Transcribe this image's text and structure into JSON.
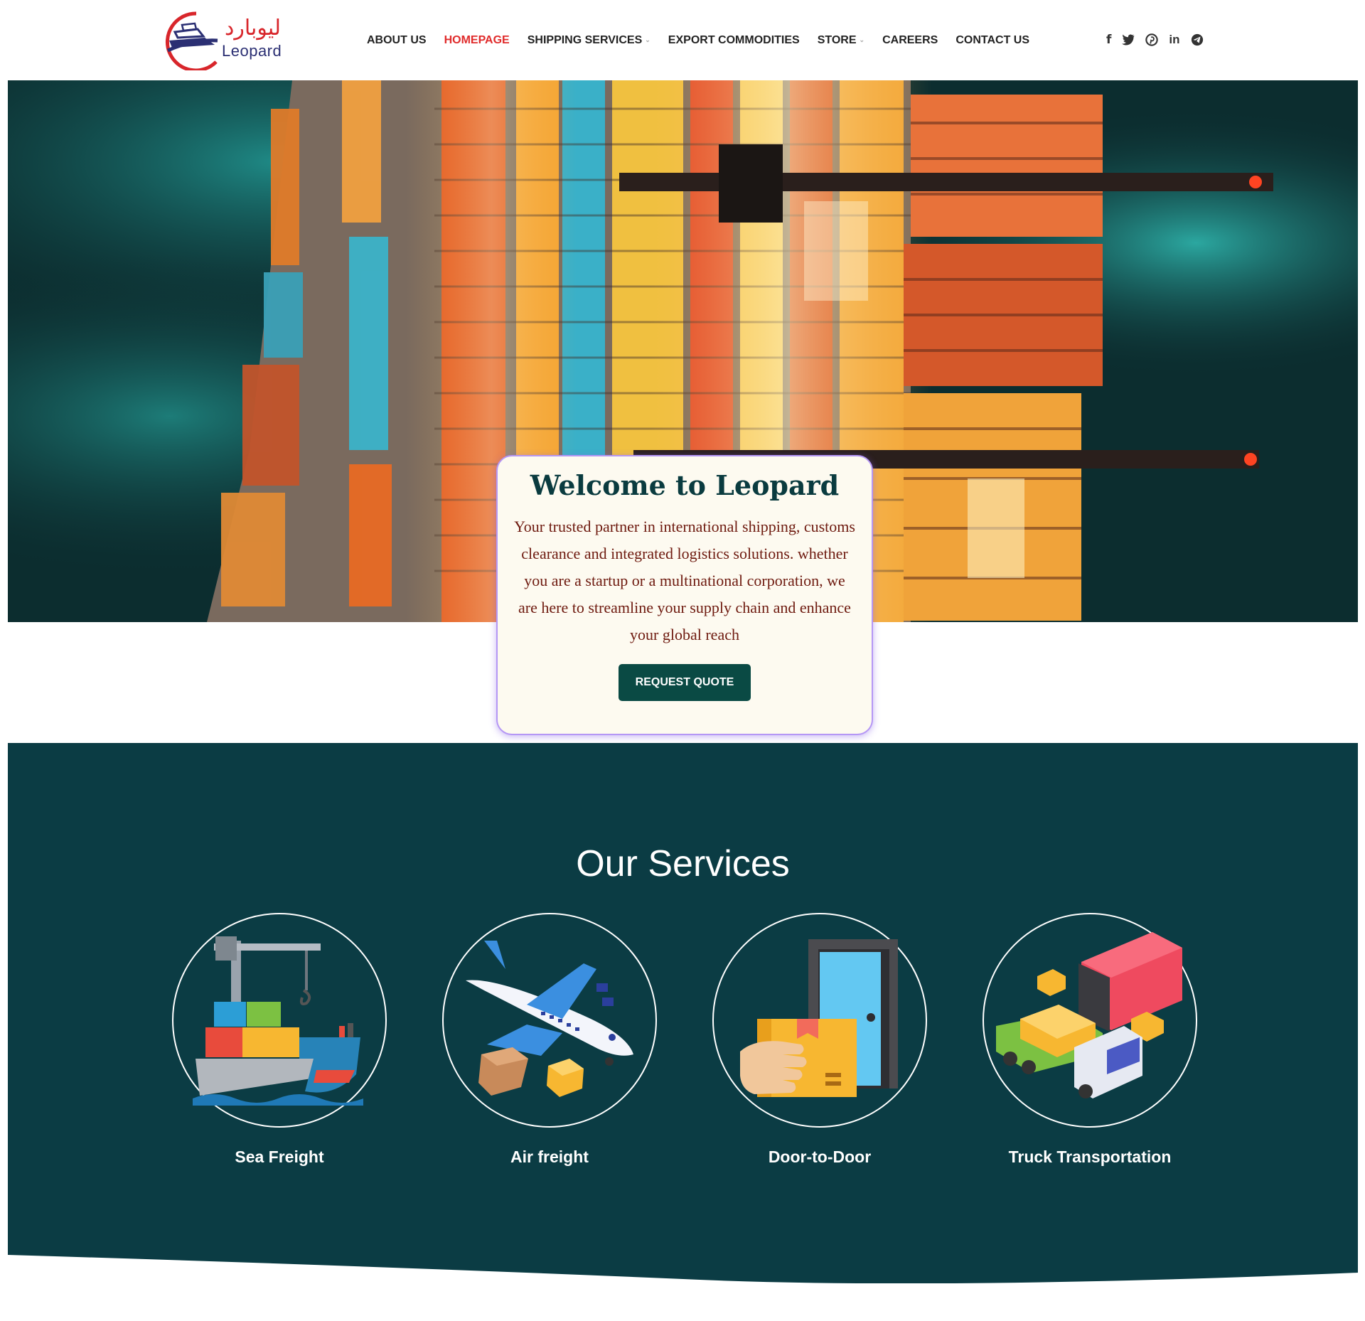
{
  "logo": {
    "arabic_text": "ليوبارد",
    "latin_text": "Leopard",
    "icon": "ship-swoosh-logo"
  },
  "nav": {
    "items": [
      {
        "label": "ABOUT US",
        "active": false,
        "dropdown": false
      },
      {
        "label": "HOMEPAGE",
        "active": true,
        "dropdown": false
      },
      {
        "label": "SHIPPING SERVICES",
        "active": false,
        "dropdown": true
      },
      {
        "label": "EXPORT COMMODITIES",
        "active": false,
        "dropdown": false
      },
      {
        "label": "STORE",
        "active": false,
        "dropdown": true
      },
      {
        "label": "CAREERS",
        "active": false,
        "dropdown": false
      },
      {
        "label": "CONTACT US",
        "active": false,
        "dropdown": false
      }
    ],
    "dropdown_icon": "chevron-down-icon"
  },
  "social": {
    "icons": [
      "facebook-icon",
      "twitter-icon",
      "pinterest-icon",
      "linkedin-icon",
      "telegram-icon"
    ],
    "facebook_glyph": "f",
    "linkedin_glyph": "in"
  },
  "hero": {
    "image": "aerial-container-port-photo"
  },
  "welcome": {
    "title": "Welcome to Leopard",
    "text": "Your trusted partner in international shipping, customs clearance and integrated logistics solutions. whether you are a startup or a multinational corporation, we are here to streamline your supply chain and enhance your global reach",
    "button_label": "REQUEST QUOTE"
  },
  "services": {
    "title": "Our Services",
    "items": [
      {
        "label": "Sea Freight",
        "icon": "cargo-ship-crane-icon"
      },
      {
        "label": "Air freight",
        "icon": "airplane-parcels-icon"
      },
      {
        "label": "Door-to-Door",
        "icon": "hand-box-door-icon"
      },
      {
        "label": "Truck Transportation",
        "icon": "truck-container-icon"
      }
    ]
  },
  "colors": {
    "accent_red": "#e02b2b",
    "teal_dark": "#0b3c44",
    "button_green": "#0a4a44",
    "card_border": "#b597f5",
    "card_text": "#6e1a0f"
  }
}
